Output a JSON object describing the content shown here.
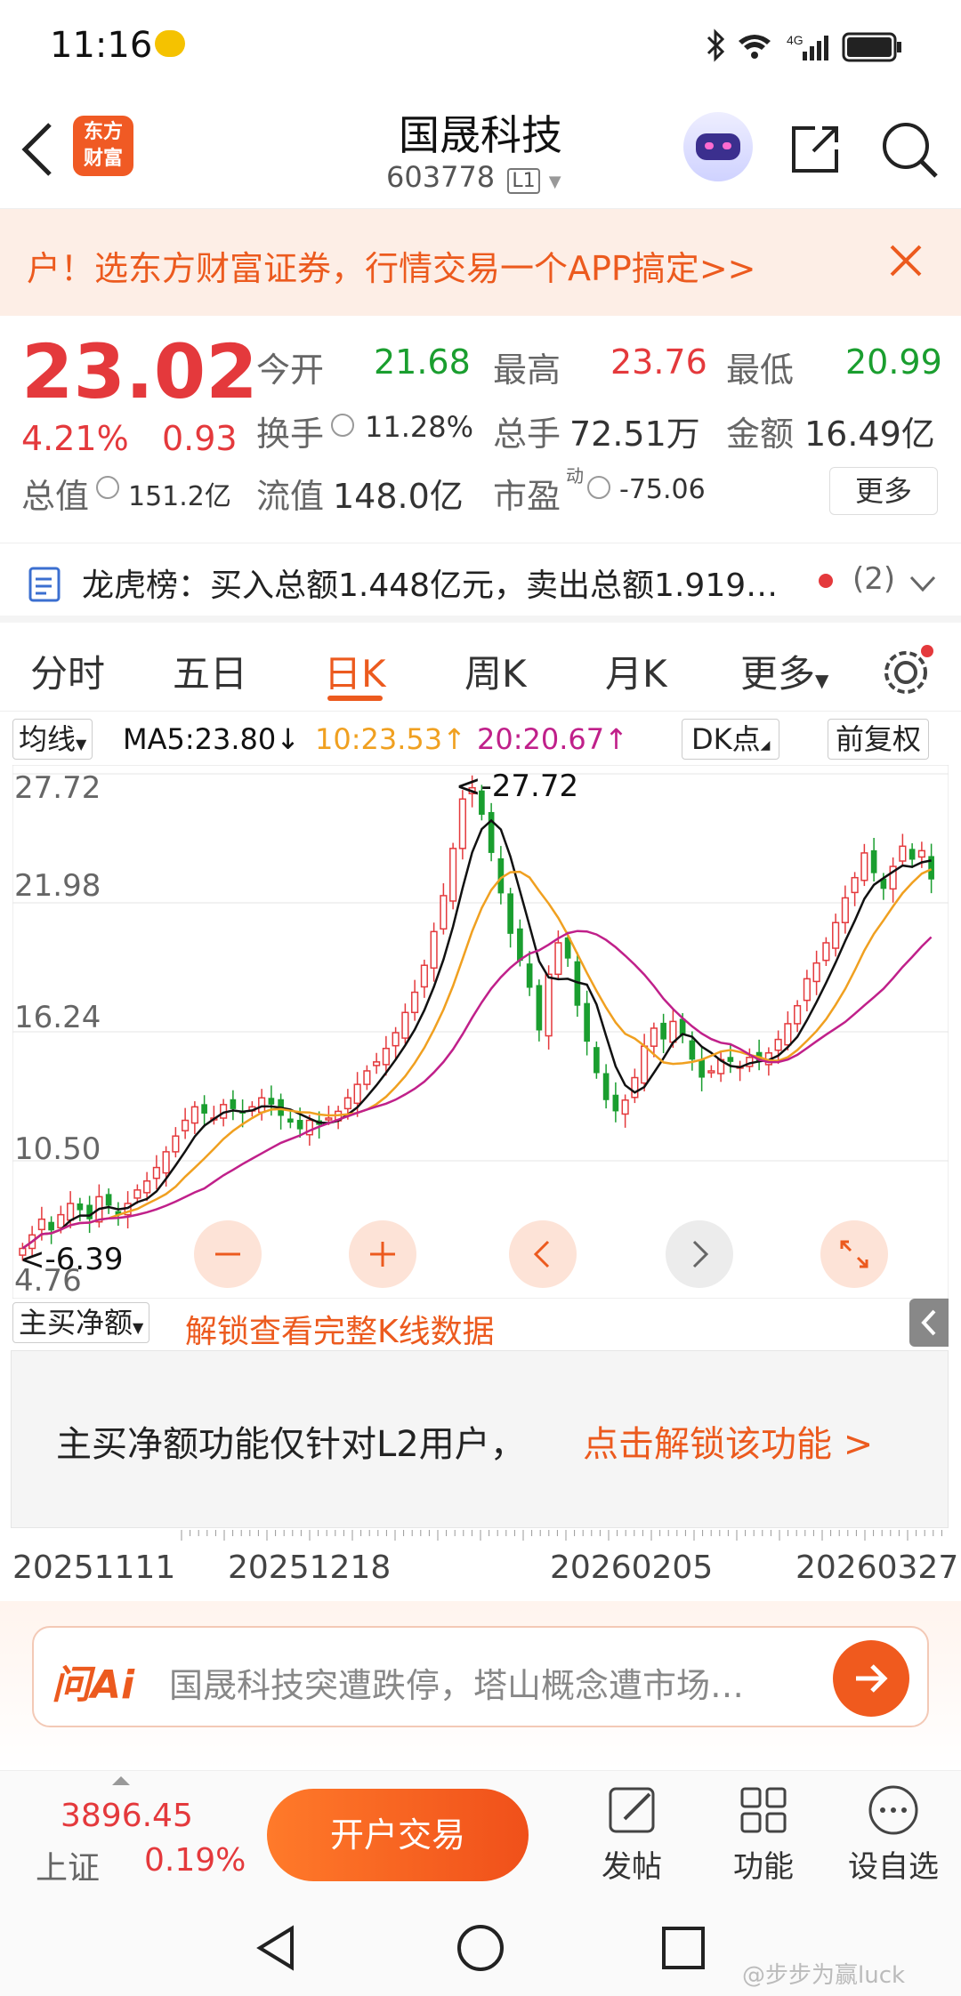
{
  "status": {
    "time": "11:16",
    "network": "4G"
  },
  "header": {
    "title": "国晟科技",
    "code": "603778",
    "level_badge": "L1",
    "logo_text": "东方财富"
  },
  "banner": {
    "text": "户！选东方财富证券，行情交易一个APP搞定>>"
  },
  "quote": {
    "price": "23.02",
    "change_pct": "4.21%",
    "change_amt": "0.93",
    "open_label": "今开",
    "open": "21.68",
    "high_label": "最高",
    "high": "23.76",
    "low_label": "最低",
    "low": "20.99",
    "turnover_label": "换手",
    "turnover": "11.28%",
    "volume_label": "总手",
    "volume": "72.51万",
    "amount_label": "金额",
    "amount": "16.49亿",
    "mktcap_label": "总值",
    "mktcap": "151.2亿",
    "float_label": "流值",
    "float": "148.0亿",
    "pe_label": "市盈",
    "pe_sup": "动",
    "pe": "-75.06",
    "more_label": "更多"
  },
  "lhb": {
    "text": "龙虎榜：买入总额1.448亿元，卖出总额1.919…",
    "count": "(2)"
  },
  "tabs": [
    "分时",
    "五日",
    "日K",
    "周K",
    "月K",
    "更多"
  ],
  "active_tab": 2,
  "chartbar": {
    "ma_select": "均线",
    "ma5": "MA5:23.80↓",
    "ma10": "10:23.53↑",
    "ma20": "20:20.67↑",
    "dk": "DK点",
    "adjust": "前复权"
  },
  "colors": {
    "up": "#e4393c",
    "down": "#1a9e2f",
    "ma5": "#111111",
    "ma10": "#f0a020",
    "ma20": "#c0208a",
    "accent": "#ff5a1f"
  },
  "chart_data": {
    "type": "candlestick",
    "ylim": [
      4.76,
      27.72
    ],
    "y_ticks": [
      "27.72",
      "21.98",
      "16.24",
      "10.50",
      "4.76"
    ],
    "max_label": "<-27.72",
    "min_label": "<-6.39",
    "x_labels": [
      "20251111",
      "20251218",
      "20260205",
      "20260327"
    ],
    "closes": [
      6.6,
      7.2,
      7.9,
      7.4,
      8.1,
      8.6,
      8.3,
      7.9,
      8.9,
      8.5,
      8.1,
      8.6,
      9.2,
      9.6,
      10.2,
      10.9,
      11.6,
      12.3,
      12.9,
      12.6,
      12.4,
      13.0,
      12.8,
      12.6,
      12.9,
      13.3,
      13.0,
      12.5,
      12.2,
      11.9,
      12.3,
      12.1,
      12.4,
      12.7,
      13.3,
      13.9,
      14.5,
      14.9,
      15.5,
      16.2,
      17.1,
      18.0,
      19.2,
      20.7,
      22.3,
      24.4,
      26.6,
      27.1,
      25.9,
      24.2,
      22.4,
      20.6,
      19.4,
      18.2,
      16.3,
      18.8,
      20.2,
      19.5,
      17.4,
      15.8,
      14.4,
      13.2,
      12.7,
      13.2,
      14.2,
      15.6,
      16.4,
      15.9,
      16.7,
      16.1,
      15.0,
      14.2,
      14.5,
      15.0,
      14.9,
      14.7,
      15.1,
      14.9,
      15.3,
      15.9,
      16.6,
      17.4,
      18.6,
      19.3,
      20.2,
      21.1,
      22.2,
      23.1,
      24.2,
      23.3,
      22.6,
      23.6,
      24.5,
      23.9,
      24.3,
      23.02
    ],
    "ma5": "MA5:23.80↓",
    "ma10": "10:23.53↑",
    "ma20": "20:20.67↑"
  },
  "sub": {
    "select": "主买净额",
    "unlock": "解锁查看完整K线数据",
    "notice": "主买净额功能仅针对L2用户，",
    "notice_link": "点击解锁该功能 >"
  },
  "ask": {
    "brand": "问Ai",
    "placeholder": "国晟科技突遭跌停，塔山概念遭市场…"
  },
  "bottom": {
    "index_value": "3896.45",
    "index_name": "上证",
    "index_pct": "0.19%",
    "trade_label": "开户交易",
    "post_label": "发帖",
    "func_label": "功能",
    "watch_label": "设自选"
  },
  "watermark": "@步步为赢luck"
}
